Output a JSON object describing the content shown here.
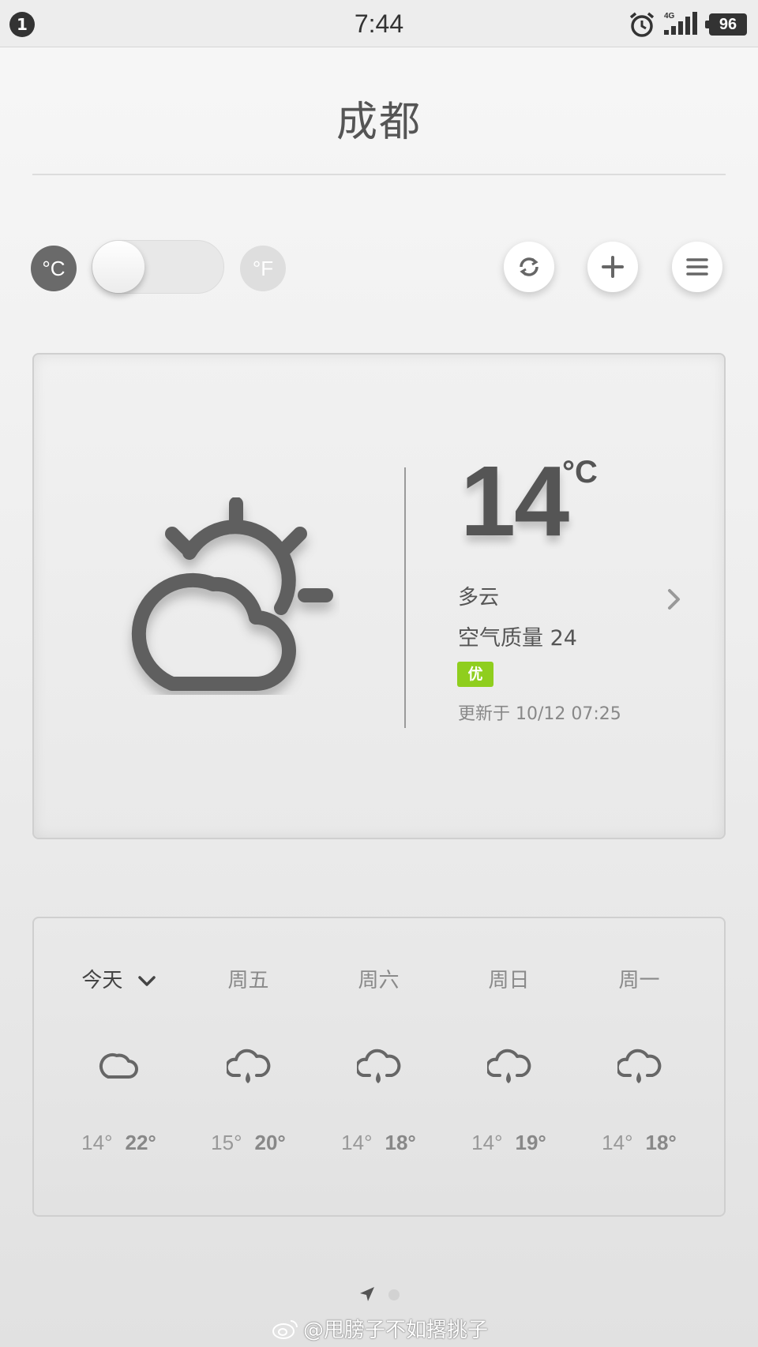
{
  "status_bar": {
    "notification_count": "1",
    "time": "7:44",
    "network": "4G",
    "battery": "96"
  },
  "city": "成都",
  "units": {
    "celsius": "°C",
    "fahrenheit": "°F",
    "selected": "celsius"
  },
  "current": {
    "temperature": "14",
    "unit": "°C",
    "condition": "多云",
    "air_quality": "空气质量 24",
    "aqi_level": "优",
    "updated": "更新于 10/12 07:25"
  },
  "forecast": [
    {
      "day": "今天",
      "icon": "cloud-icon",
      "low": "14°",
      "high": "22°"
    },
    {
      "day": "周五",
      "icon": "rain-cloud-icon",
      "low": "15°",
      "high": "20°"
    },
    {
      "day": "周六",
      "icon": "rain-cloud-icon",
      "low": "14°",
      "high": "18°"
    },
    {
      "day": "周日",
      "icon": "rain-cloud-icon",
      "low": "14°",
      "high": "19°"
    },
    {
      "day": "周一",
      "icon": "rain-cloud-icon",
      "low": "14°",
      "high": "18°"
    }
  ],
  "pager": {
    "pages": 2,
    "current": 1
  },
  "watermark": "@甩膀子不如撂挑子",
  "colors": {
    "aqi_good": "#8fce1e",
    "icon_dark": "#5f5f5f"
  }
}
